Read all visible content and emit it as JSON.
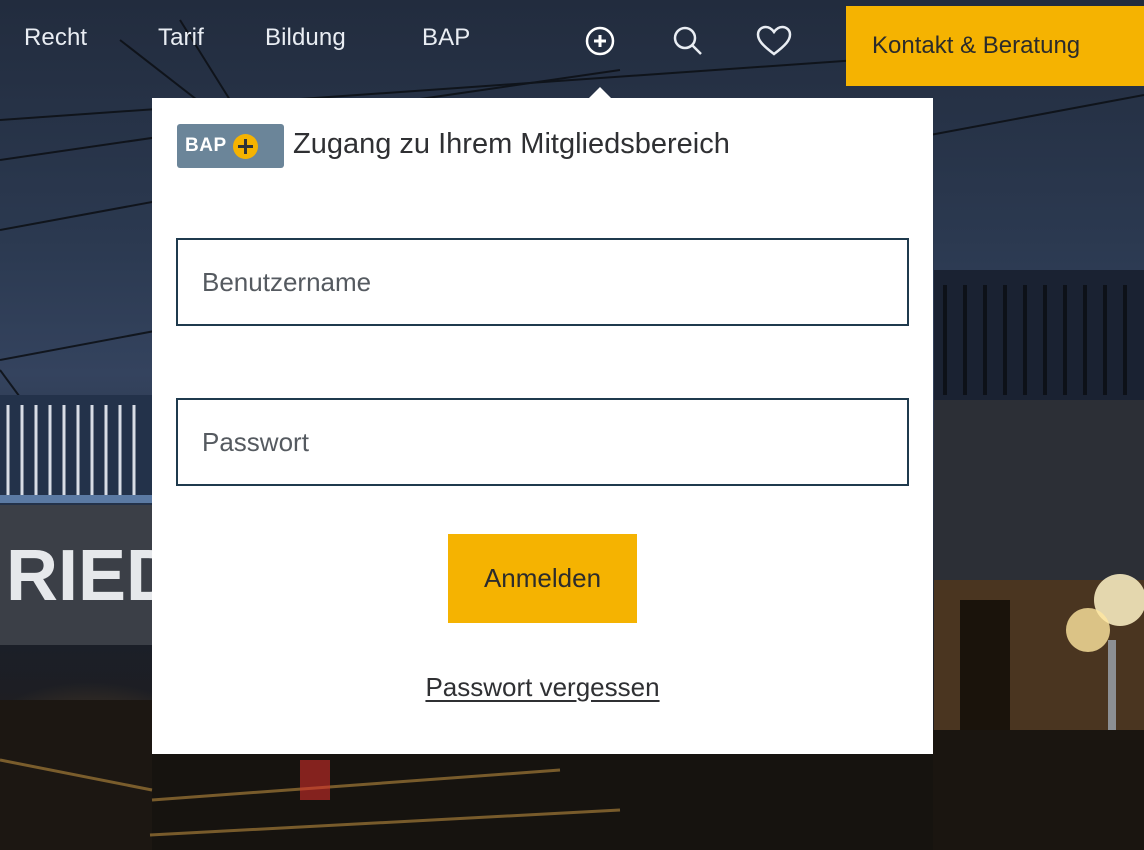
{
  "nav": {
    "links": [
      {
        "label": "Recht"
      },
      {
        "label": "Tarif"
      },
      {
        "label": "Bildung"
      },
      {
        "label": "BAP"
      }
    ],
    "icons": [
      "plus-circle-icon",
      "search-icon",
      "heart-icon"
    ],
    "contact_label": "Kontakt & Beratung"
  },
  "background": {
    "station_sign_fragment": "RIED"
  },
  "login": {
    "badge_text": "BAP",
    "heading": "Zugang zu Ihrem Mitgliedsbereich",
    "username_placeholder": "Benutzername",
    "password_placeholder": "Passwort",
    "submit_label": "Anmelden",
    "forgot_label": "Passwort vergessen"
  },
  "colors": {
    "accent": "#f5b301",
    "badge": "#6b8599",
    "field_border": "#1f3a4d"
  }
}
